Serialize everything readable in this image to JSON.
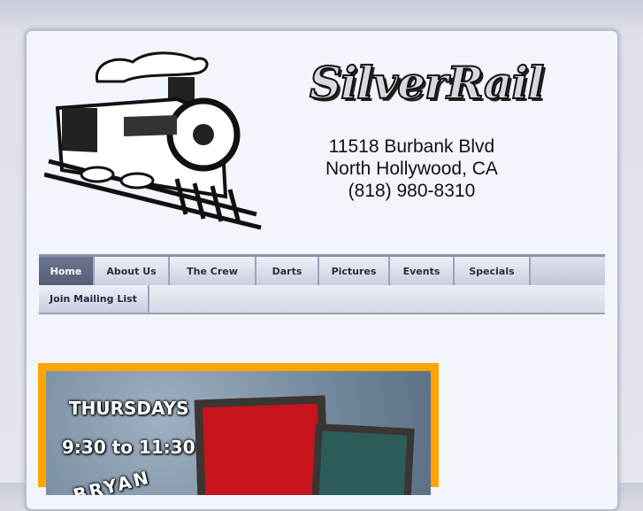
{
  "logo": {
    "text": "SilverRail"
  },
  "address": {
    "line1": "11518 Burbank Blvd",
    "line2": "North Hollywood, CA",
    "phone": "(818) 980-8310"
  },
  "nav": {
    "items": [
      {
        "label": "Home",
        "active": true
      },
      {
        "label": "About Us"
      },
      {
        "label": "The Crew"
      },
      {
        "label": "Darts"
      },
      {
        "label": "Pictures"
      },
      {
        "label": "Events"
      },
      {
        "label": "Specials"
      }
    ],
    "row2": [
      {
        "label": "Join Mailing List"
      }
    ]
  },
  "promo": {
    "day": "THURSDAYS",
    "time": "9:30 to 11:30",
    "name": "BRYAN"
  },
  "colors": {
    "accent": "#ffa500",
    "nav_active": "#5f6681"
  }
}
